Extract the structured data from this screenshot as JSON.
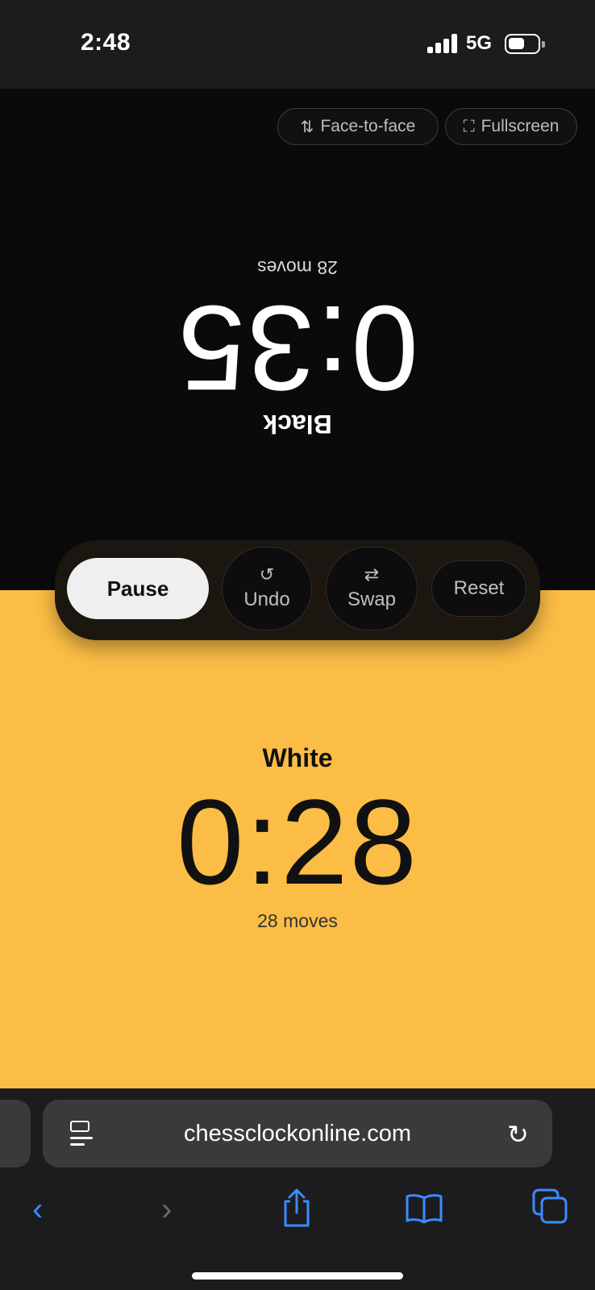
{
  "status_bar": {
    "time": "2:48",
    "network": "5G",
    "battery_level": 0.55
  },
  "top_buttons": {
    "face_to_face": {
      "label": "Face-to-face",
      "icon": "arrows-up-down-icon"
    },
    "fullscreen": {
      "label": "Fullscreen",
      "icon": "fullscreen-icon"
    }
  },
  "black_player": {
    "name": "Black",
    "time": "0:35",
    "moves": "28 moves",
    "background": "#0a0a0a",
    "orientation": "upside-down"
  },
  "controls": {
    "pause": "Pause",
    "undo": {
      "label": "Undo",
      "icon": "undo-icon"
    },
    "swap": {
      "label": "Swap",
      "icon": "swap-icon"
    },
    "reset": "Reset"
  },
  "white_player": {
    "name": "White",
    "time": "0:28",
    "moves": "28 moves",
    "background": "#fbbd45"
  },
  "browser": {
    "url": "chessclockonline.com",
    "nav_icons": [
      "back-icon",
      "forward-icon",
      "share-icon",
      "bookmarks-icon",
      "tabs-icon"
    ],
    "accent": "#3b8cff"
  }
}
